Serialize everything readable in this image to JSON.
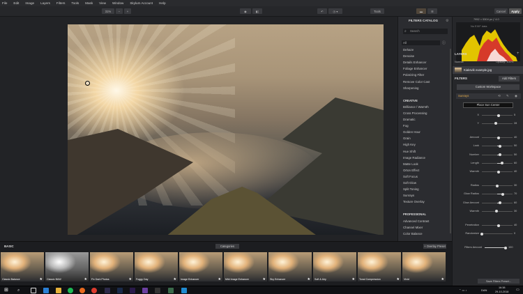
{
  "menu": [
    "File",
    "Edit",
    "Image",
    "Layers",
    "Filters",
    "Tools",
    "Mask",
    "View",
    "Window",
    "Skylum Account",
    "Help"
  ],
  "toolbar": {
    "zoom": "31%",
    "tools": "Tools",
    "cancel": "Cancel",
    "apply": "Apply"
  },
  "catalog": {
    "title": "FILTERS CATALOG",
    "search_placeholder": "Search",
    "filter_select": "All",
    "items_top": [
      "Dehaze",
      "Denoise",
      "Details Enhancer",
      "Foliage Enhancer",
      "Polarizing Filter",
      "Remove Color Cast",
      "Sharpening"
    ],
    "creative_header": "CREATIVE",
    "items_creative": [
      "Brilliance / Warmth",
      "Cross Processing",
      "Dramatic",
      "Fog",
      "Golden Hour",
      "Grain",
      "High Key",
      "Hue Shift",
      "Image Radiance",
      "Matte Look",
      "Orton Effect",
      "Soft Focus",
      "Soft Glow",
      "Split Toning",
      "Sunrays",
      "Texture Overlay"
    ],
    "professional_header": "PROFESSIONAL",
    "items_professional": [
      "Advanced Contrast",
      "Channel Mixer",
      "Color Balance"
    ]
  },
  "right": {
    "histo_info": "7952 × 5304 px   ƒ 4.0",
    "no_exif": "No EXIF data",
    "layers_title": "LAYERS",
    "blend_mode": "Normal",
    "opacity": "Opacity: 100%",
    "layer_name": "Kiaksvik example.jpg",
    "filters_title": "FILTERS",
    "add_filters": "Add Filters",
    "workspace": "Custom Workspace",
    "sunrays_label": "Sunrays",
    "place_sun": "Place Sun Center",
    "sliders1": [
      {
        "label": "X",
        "value": "5",
        "pos": 0.55
      },
      {
        "label": "Y",
        "value": "28",
        "pos": 0.46
      }
    ],
    "sliders2": [
      {
        "label": "Amount",
        "value": "40",
        "pos": 0.55
      },
      {
        "label": "Look",
        "value": "50",
        "pos": 0.6
      },
      {
        "label": "Number",
        "value": "50",
        "pos": 0.58
      },
      {
        "label": "Length",
        "value": "60",
        "pos": 0.65
      },
      {
        "label": "Warmth",
        "value": "40",
        "pos": 0.55
      }
    ],
    "sliders3": [
      {
        "label": "Radius",
        "value": "30",
        "pos": 0.5
      },
      {
        "label": "Glow Radius",
        "value": "70",
        "pos": 0.68
      },
      {
        "label": "Glow Amount",
        "value": "60",
        "pos": 0.58
      },
      {
        "label": "Warmth",
        "value": "30",
        "pos": 0.47
      }
    ],
    "sliders4": [
      {
        "label": "Penetration",
        "value": "40",
        "pos": 0.55
      },
      {
        "label": "Randomize",
        "value": "0",
        "pos": 0.0
      }
    ],
    "filters_amount_label": "Filters Amount",
    "filters_amount_value": "100",
    "save_preset": "Save Filters Preset..."
  },
  "presets": {
    "section": "BASIC",
    "categories": "Categories",
    "overlay": "+ Overlay Preset",
    "thumbs": [
      "Classic Balance",
      "Classic B&W",
      "Fix Dark Photos",
      "Foggy Day",
      "Image Enhancer",
      "Mild Image Enhancer",
      "Sky Enhancer",
      "Soft & Airy",
      "Tonal Compression",
      "Vivid"
    ]
  },
  "taskbar": {
    "time": "16:38",
    "date": "29-10-2018",
    "lang": "DAN"
  }
}
